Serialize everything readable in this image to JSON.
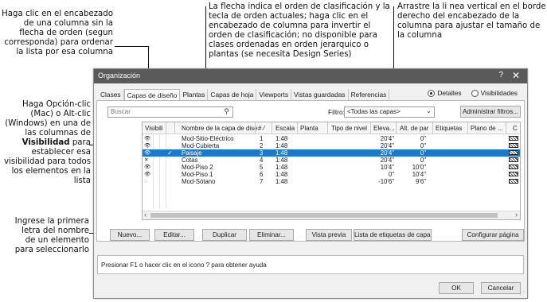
{
  "callouts": {
    "sort_click_lines": [
      "Haga clic en el encabezado",
      "de una columna sin la",
      "flecha de orden (segun",
      "corresponda) para ordenar",
      "la lista por esa columna"
    ],
    "sort_arrow_lines": [
      "La flecha indica el orden de clasificación y la",
      "tecla de orden actuales; haga clic en el",
      "encabezado de columna para invertir el",
      "orden de clasificación; no disponible para",
      "clases ordenadas en orden jerarquico o",
      "plantas (se necesita Design Series)"
    ],
    "resize_lines": [
      "Arrastre la li nea vertical en el borde",
      "derecho del encabezado de la",
      "columna para ajustar el tamaño de",
      "la columna"
    ],
    "visibility_lines": [
      "Haga Opción-clic",
      "(Mac) o Alt-clic",
      "(Windows) en una de",
      "las columnas de",
      "para",
      "establecer esa",
      "visibilidad para todos",
      "los elementos en la",
      "lista"
    ],
    "visibility_bold": "Visibilidad",
    "type_lines": [
      "Ingrese la primera",
      "letra del nombre",
      "de un elemento",
      "para seleccionarlo"
    ]
  },
  "dialog": {
    "title": "Organización",
    "help_glyph": "?",
    "close_glyph": "✕",
    "tabs": [
      "Clases",
      "Capas de diseño",
      "Plantas",
      "Capas de hoja",
      "Viewports",
      "Vistas guardadas",
      "Referencias"
    ],
    "active_tab_index": 1,
    "radio_details": "Detalles",
    "radio_visibilities": "Visibilidades",
    "search_placeholder": "Buscar",
    "filter_label": "Filtro:",
    "filter_value": "<Todas las capas>",
    "admin_filters": "Administrar filtros...",
    "columns": [
      "Visibili",
      "Nombre de la capa de dise",
      "#",
      "Escala",
      "Planta",
      "Tipo de nivel",
      "Eleva...",
      "Alt. de par",
      "Etiquetas",
      "Plano de ...",
      "C"
    ],
    "rows": [
      {
        "vis": "👁",
        "name": "Mod-Sitio-Eléctrico",
        "num": "1",
        "scale": "1:48",
        "elev": "20'4\"",
        "wall": "0\"",
        "selected": false
      },
      {
        "vis": "👁",
        "name": "Mod-Cubierta",
        "num": "2",
        "scale": "1:48",
        "elev": "20'4\"",
        "wall": "0\"",
        "selected": false
      },
      {
        "vis": "👁",
        "check": "✓",
        "name": "Paisaje",
        "num": "3",
        "scale": "1:48",
        "elev": "20'4\"",
        "wall": "0\"",
        "selected": true
      },
      {
        "vis": "✕",
        "name": "Cotas",
        "num": "4",
        "scale": "1:48",
        "elev": "20'4\"",
        "wall": "0\"",
        "selected": false
      },
      {
        "vis": "👁",
        "name": "Mod-Piso 2",
        "num": "5",
        "scale": "1:48",
        "elev": "10'4\"",
        "wall": "10'0\"",
        "selected": false
      },
      {
        "vis": "👁",
        "name": "Mod-Piso 1",
        "num": "6",
        "scale": "1:48",
        "elev": "0\"",
        "wall": "10'4\"",
        "selected": false
      },
      {
        "vis": "◌",
        "name": "Mod-Sótano",
        "num": "7",
        "scale": "1:48",
        "elev": "-10'6\"",
        "wall": "9'6\"",
        "selected": false
      }
    ],
    "buttons": [
      "Nuevo...",
      "Editar...",
      "Duplicar",
      "Eliminar...",
      "Vista previa",
      "Lista de etiquetas de capa...",
      "Configurar página"
    ],
    "help_text": "Presionar F1 o hacer clic en el icono ? para obtener ayuda",
    "ok": "OK",
    "cancel": "Cancelar"
  }
}
